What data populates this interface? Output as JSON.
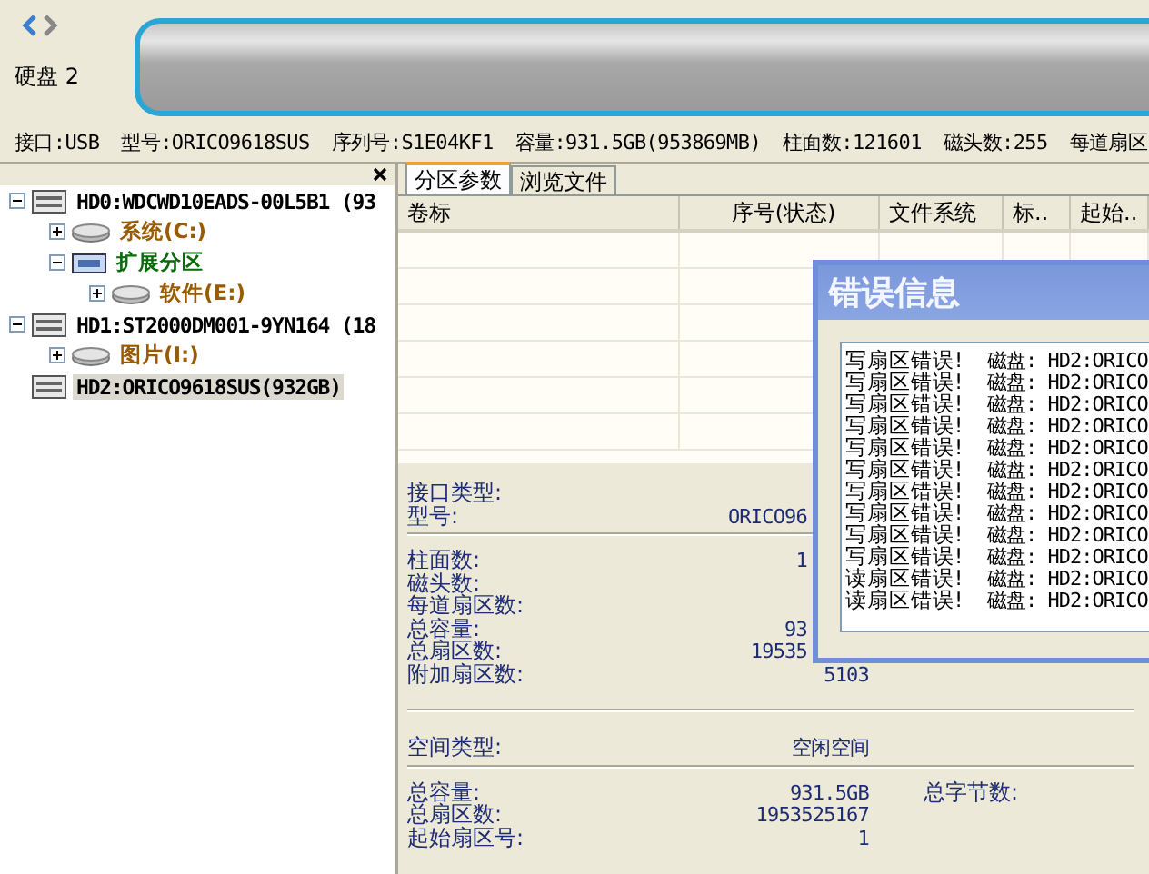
{
  "disk_header": {
    "label": "硬盘 2",
    "info": [
      "接口:USB",
      "型号:ORICO9618SUS",
      "序列号:S1E04KF1",
      "容量:931.5GB(953869MB)",
      "柱面数:121601",
      "磁头数:255",
      "每道扇区"
    ]
  },
  "tree": {
    "items": [
      {
        "label": "HD0:WDCWD10EADS-00L5B1 (93",
        "kind": "disk",
        "expanded": true,
        "selected": false,
        "children": [
          {
            "label": "系统(C:)",
            "kind": "partition",
            "expanded": false,
            "selected": false
          },
          {
            "label": "扩展分区",
            "kind": "extended",
            "expanded": true,
            "selected": false,
            "children": [
              {
                "label": "软件(E:)",
                "kind": "partition",
                "expanded": false,
                "selected": false
              }
            ]
          }
        ]
      },
      {
        "label": "HD1:ST2000DM001-9YN164 (18",
        "kind": "disk",
        "expanded": true,
        "selected": false,
        "children": [
          {
            "label": "图片(I:)",
            "kind": "partition",
            "expanded": false,
            "selected": false
          }
        ]
      },
      {
        "label": "HD2:ORICO9618SUS(932GB)",
        "kind": "disk",
        "selected": true
      }
    ]
  },
  "tabs": [
    {
      "label": "分区参数",
      "selected": true
    },
    {
      "label": "浏览文件",
      "selected": false
    }
  ],
  "table": {
    "columns": [
      "卷标",
      "序号(状态)",
      "文件系统",
      "标..",
      "起始.."
    ]
  },
  "disk_params": [
    {
      "label": "接口类型:"
    },
    {
      "label": "型号:",
      "value": "ORICO96"
    }
  ],
  "geometry": [
    {
      "label": "柱面数:",
      "value": "1"
    },
    {
      "label": "磁头数:"
    },
    {
      "label": "每道扇区数:"
    },
    {
      "label": "总容量:",
      "value": "93"
    },
    {
      "label": "总扇区数:",
      "value": "19535"
    },
    {
      "label": "附加扇区数:",
      "value": "5103"
    }
  ],
  "space_type": {
    "label": "空间类型:",
    "value": "空闲空间"
  },
  "space": [
    {
      "label": "总容量:",
      "value": "931.5GB",
      "extra": "总字节数:"
    },
    {
      "label": "总扇区数:",
      "value": "1953525167"
    },
    {
      "label": "起始扇区号:",
      "value": "1"
    }
  ],
  "error_dialog": {
    "title": "错误信息",
    "lines": [
      {
        "message": "写扇区错误!",
        "detail": "磁盘: HD2:ORICO"
      },
      {
        "message": "写扇区错误!",
        "detail": "磁盘: HD2:ORICO"
      },
      {
        "message": "写扇区错误!",
        "detail": "磁盘: HD2:ORICO"
      },
      {
        "message": "写扇区错误!",
        "detail": "磁盘: HD2:ORICO"
      },
      {
        "message": "写扇区错误!",
        "detail": "磁盘: HD2:ORICO"
      },
      {
        "message": "写扇区错误!",
        "detail": "磁盘: HD2:ORICO"
      },
      {
        "message": "写扇区错误!",
        "detail": "磁盘: HD2:ORICO"
      },
      {
        "message": "写扇区错误!",
        "detail": "磁盘: HD2:ORICO"
      },
      {
        "message": "写扇区错误!",
        "detail": "磁盘: HD2:ORICO"
      },
      {
        "message": "写扇区错误!",
        "detail": "磁盘: HD2:ORICO"
      },
      {
        "message": "读扇区错误!",
        "detail": "磁盘: HD2:ORICO"
      },
      {
        "message": "读扇区错误!",
        "detail": "磁盘: HD2:ORICO"
      }
    ]
  }
}
